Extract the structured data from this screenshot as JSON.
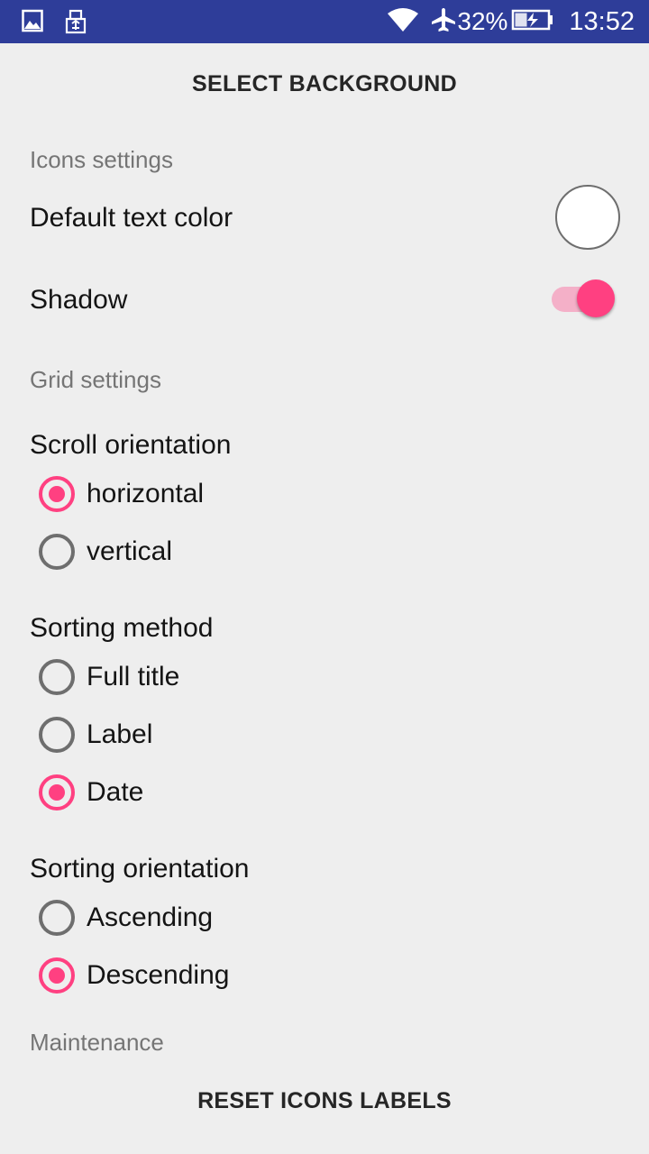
{
  "status_bar": {
    "battery": "32%",
    "time": "13:52",
    "icons": [
      "image-icon",
      "usb-icon",
      "wifi-icon",
      "airplane-mode-icon",
      "battery-charging-icon"
    ]
  },
  "actions": {
    "select_background": "SELECT BACKGROUND",
    "reset_icons_labels": "RESET ICONS LABELS"
  },
  "icons_settings": {
    "header": "Icons settings",
    "default_text_color_label": "Default text color",
    "default_text_color_value": "#ffffff",
    "shadow_label": "Shadow",
    "shadow_enabled": true
  },
  "grid_settings": {
    "header": "Grid settings",
    "scroll_orientation": {
      "title": "Scroll orientation",
      "options": [
        "horizontal",
        "vertical"
      ],
      "selected": "horizontal"
    },
    "sorting_method": {
      "title": "Sorting method",
      "options": [
        "Full title",
        "Label",
        "Date"
      ],
      "selected": "Date"
    },
    "sorting_orientation": {
      "title": "Sorting orientation",
      "options": [
        "Ascending",
        "Descending"
      ],
      "selected": "Descending"
    }
  },
  "maintenance": {
    "header": "Maintenance"
  },
  "colors": {
    "status_bar": "#2e3d99",
    "accent": "#ff4081",
    "background": "#eeeeee"
  }
}
